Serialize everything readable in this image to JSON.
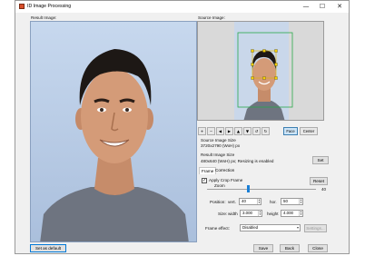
{
  "window": {
    "title": "ID Image Processing",
    "controls": [
      "—",
      "☐",
      "✕"
    ]
  },
  "result_label": "Result Image:",
  "source_label": "Source Image:",
  "toolbar": {
    "buttons": [
      "+",
      "−",
      "◀",
      "▶",
      "▲",
      "▼",
      "↺",
      "↻"
    ],
    "face_label": "Face",
    "center_label": "Center"
  },
  "source_info": {
    "size_label": "Source Image Size",
    "size_value": "3720x2790 (WxH) px"
  },
  "result_info": {
    "size_label": "Result Image Size",
    "size_value": "480x640 (WxH) px; Resizing is enabled",
    "set_label": "Set"
  },
  "tabs": {
    "frame": "Frame",
    "correction": "Correction"
  },
  "frame": {
    "apply_crop_label": "Apply Crop Frame",
    "apply_crop_checked": true,
    "reset_label": "Reset",
    "zoom_label": "Zoom",
    "zoom_value": "40",
    "position_label": "Position:",
    "vert_label": "vert.",
    "vert_value": "40",
    "hor_label": "hor.",
    "hor_value": "50",
    "size_label": "Size:",
    "width_label": "width",
    "width_value": "3.000",
    "height_label": "height",
    "height_value": "4.000",
    "effect_label": "Frame effect:",
    "effect_value": "Disabled",
    "settings_label": "Settings..."
  },
  "footer": {
    "set_default_label": "Set as default",
    "save_label": "Save",
    "back_label": "Back",
    "close_label": "Close"
  }
}
